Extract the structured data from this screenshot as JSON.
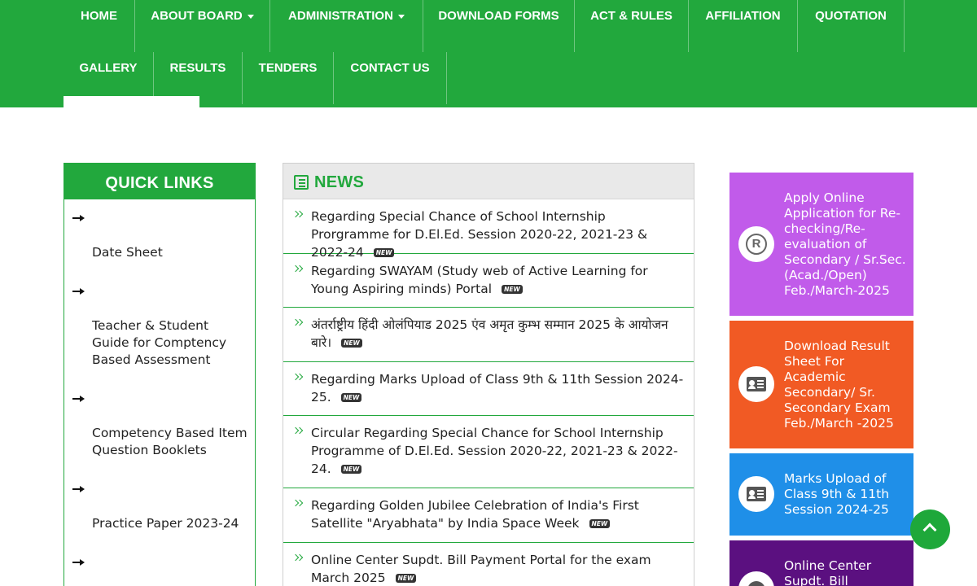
{
  "nav": {
    "row1": [
      {
        "label": "HOME",
        "caret": false
      },
      {
        "label": "ABOUT BOARD",
        "caret": true
      },
      {
        "label": "ADMINISTRATION",
        "caret": true
      },
      {
        "label": "DOWNLOAD FORMS",
        "caret": false
      },
      {
        "label": "ACT & RULES",
        "caret": false
      },
      {
        "label": "AFFILIATION",
        "caret": false
      },
      {
        "label": "QUOTATION",
        "caret": false
      }
    ],
    "row2": [
      {
        "label": "GALLERY"
      },
      {
        "label": "RESULTS"
      },
      {
        "label": "TENDERS"
      },
      {
        "label": "CONTACT US"
      }
    ],
    "brand_color": "#22a83d"
  },
  "quick_links": {
    "title": "QUICK LINKS",
    "items": [
      "Date Sheet",
      "Teacher & Student Guide for Comptency Based Assessment",
      "Competency Based Item Question Booklets",
      "Practice Paper 2023-24"
    ]
  },
  "news": {
    "title": "NEWS",
    "badge": "NEW",
    "items": [
      "Regarding Special Chance of School Internship Prorgramme for D.El.Ed. Session 2020-22, 2021-23 & 2022-24",
      "Regarding SWAYAM (Study web of Active Learning for Young Aspiring minds) Portal",
      "अंतर्राष्ट्रीय हिंदी ओलंपियाड 2025 एंव अमृत कुम्भ सम्मान 2025 के आयोजन बारे।",
      "Regarding Marks Upload of Class 9th & 11th Session 2024-25.",
      "Circular Regarding Special Chance for School Internship Programme of D.El.Ed. Session 2020-22, 2021-23 & 2022-24.",
      "Regarding Golden Jubilee Celebration of India's First Satellite \"Aryabhata\" by India Space Week",
      "Online Center Supdt. Bill Payment Portal for the exam March 2025"
    ]
  },
  "cards": [
    {
      "text": "Apply Online Application for Re-checking/Re-evaluation of Secondary / Sr.Sec. (Acad./Open) Feb./March-2025",
      "icon": "registered-icon",
      "color": "#c15bea"
    },
    {
      "text": "Download Result Sheet For Academic Secondary/ Sr. Secondary Exam Feb./March -2025",
      "icon": "id-card-icon",
      "color": "#f15a24"
    },
    {
      "text": "Marks Upload of Class 9th & 11th Session 2024-25",
      "icon": "id-card-icon",
      "color": "#1f8fe8"
    },
    {
      "text": "Online Center Supdt. Bill Payment",
      "icon": "user-icon",
      "color": "#5b1080"
    }
  ]
}
